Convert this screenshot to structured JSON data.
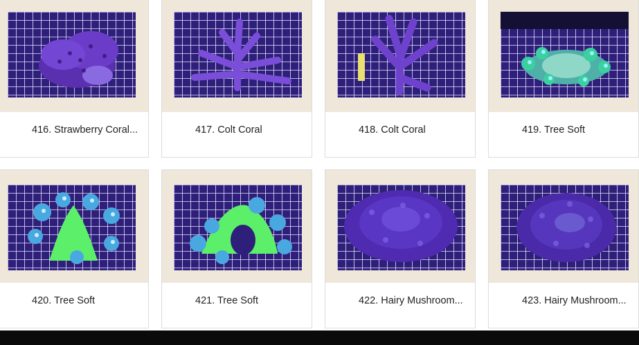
{
  "products": [
    {
      "label": "416. Strawberry Coral...",
      "image": "strawberry-coral-photo"
    },
    {
      "label": "417. Colt Coral",
      "image": "colt-coral-photo"
    },
    {
      "label": "418. Colt Coral",
      "image": "colt-coral-photo"
    },
    {
      "label": "419. Tree Soft",
      "image": "tree-soft-photo"
    },
    {
      "label": "420. Tree Soft",
      "image": "tree-soft-photo"
    },
    {
      "label": "421. Tree Soft",
      "image": "tree-soft-photo"
    },
    {
      "label": "422. Hairy Mushroom...",
      "image": "hairy-mushroom-photo"
    },
    {
      "label": "423. Hairy Mushroom...",
      "image": "hairy-mushroom-photo"
    }
  ],
  "colors": {
    "thumb_background": "#eee7da",
    "tank_blue": "#2a1a6e",
    "grid_white": "#e8e4ff",
    "coral_purple": "#6a3cc8",
    "coral_green": "#5cf06a",
    "bottom_bar": "#0a0a0a"
  }
}
